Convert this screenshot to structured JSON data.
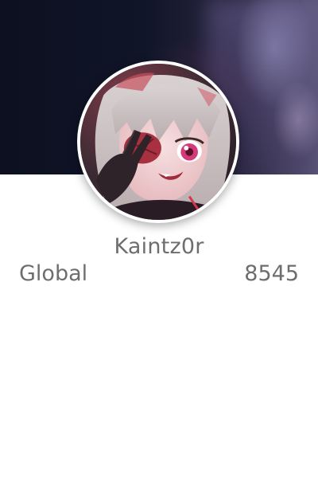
{
  "profile": {
    "username": "Kaintz0r",
    "avatar_alt": "anime-girl-avatar"
  },
  "ranking": {
    "label": "Global",
    "value": "8545"
  },
  "colors": {
    "text": "#6e6e6e",
    "banner_dark": "#0c1020",
    "avatar_border": "#ffffff"
  }
}
